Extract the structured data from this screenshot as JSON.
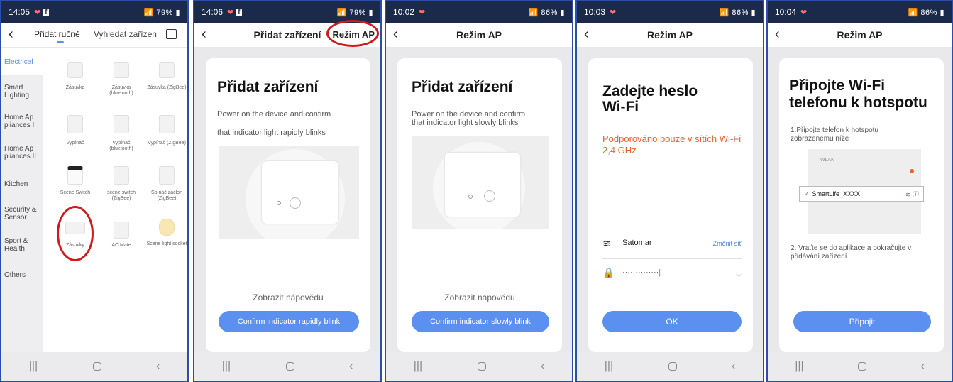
{
  "phones": [
    {
      "status": {
        "time": "14:05",
        "right": "79%"
      },
      "tabs": {
        "manual": "Přidat ručně",
        "scan": "Vyhledat zařízen"
      },
      "sidebar": [
        "Electrical",
        "Smart Lighting",
        "Home Ap pliances I",
        "Home Ap pliances II",
        "Kitchen",
        "Security & Sensor",
        "Sport & Health",
        "Others"
      ],
      "devices": [
        "Zásuvka",
        "Zásuvka (bluetooth)",
        "Zásuvka (ZigBee)",
        "Vypínač",
        "Vypínač (bluetooth)",
        "Vypínač (ZigBee)",
        "Scene Switch",
        "scene switch (ZigBee)",
        "Spínač záclon (ZigBee)",
        "Zásuvky",
        "AC Mate",
        "Scene light socket"
      ]
    },
    {
      "status": {
        "time": "14:06",
        "right": "79%"
      },
      "title": "Přidat zařízení",
      "action": "Režim AP",
      "card_title": "Přidat zařízení",
      "line1": "Power on the device and confirm",
      "line2": "that indicator light rapidly blinks",
      "help": "Zobrazit nápovědu",
      "button": "Confirm indicator rapidly blink"
    },
    {
      "status": {
        "time": "10:02",
        "right": "86%"
      },
      "title": "Režim AP",
      "card_title": "Přidat zařízení",
      "line1": "Power on the device and confirm",
      "line2": "that indicator light slowly blinks",
      "help": "Zobrazit nápovědu",
      "button": "Confirm indicator slowly blink"
    },
    {
      "status": {
        "time": "10:03",
        "right": "86%"
      },
      "title": "Režim AP",
      "card_title_1": "Zadejte heslo",
      "card_title_2": "Wi-Fi",
      "warning_1": "Podporováno pouze v sítích Wi-Fi",
      "warning_2": "2,4 GHz",
      "ssid": "Satomar",
      "change": "Změnit síť",
      "password": "··············",
      "button": "OK",
      "accent": "#e8652a"
    },
    {
      "status": {
        "time": "10:04",
        "right": "86%"
      },
      "title": "Režim AP",
      "card_title_1": "Připojte Wi-Fi",
      "card_title_2": "telefonu k hotspotu",
      "step1_a": "1.Připojte telefon k hotspotu",
      "step1_b": "zobrazenému níže",
      "wlan": "WLAN",
      "network": "SmartLife_XXXX",
      "step2_a": "2. Vraťte se do aplikace a pokračujte v",
      "step2_b": "přidávání zařízení",
      "button": "Připojit"
    }
  ]
}
